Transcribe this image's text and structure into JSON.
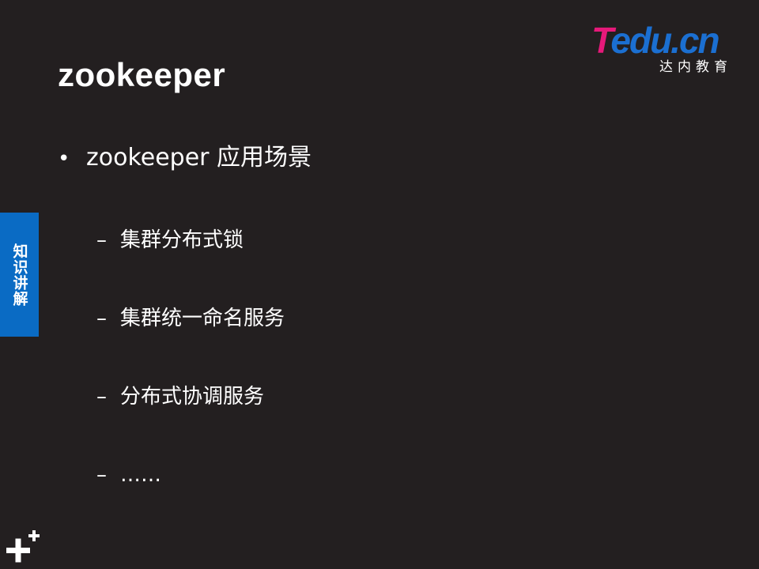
{
  "slide": {
    "title": "zookeeper",
    "logo": {
      "brand_t": "T",
      "brand_rest": "edu.cn",
      "subtitle": "达内教育"
    },
    "side_tab": "知识讲解",
    "bullet": {
      "marker": "•",
      "text": "zookeeper 应用场景"
    },
    "subitems": [
      {
        "marker": "–",
        "text": "集群分布式锁"
      },
      {
        "marker": "–",
        "text": "集群统一命名服务"
      },
      {
        "marker": "–",
        "text": "分布式协调服务"
      },
      {
        "marker": "–",
        "text": "……"
      }
    ],
    "colors": {
      "background": "#231f20",
      "accent_blue": "#0a6bc4",
      "logo_pink": "#e6197a",
      "logo_blue": "#1b6fd1"
    },
    "icons": {
      "corner": "plus-icon"
    }
  }
}
